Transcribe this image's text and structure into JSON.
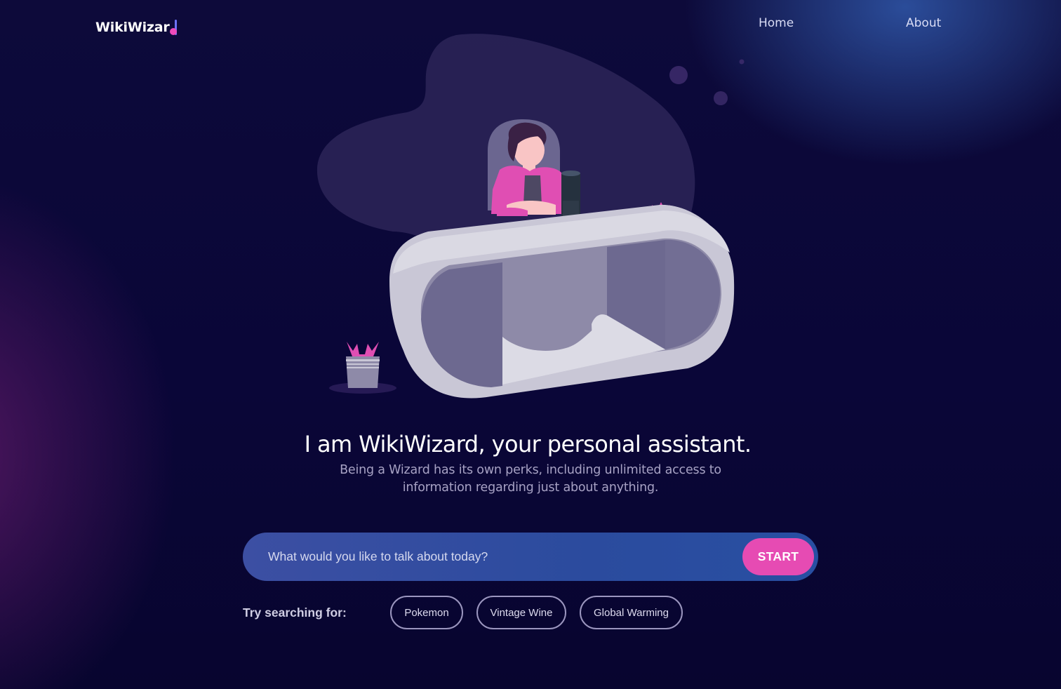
{
  "app": {
    "logo_text": "WikiWizar"
  },
  "nav": {
    "home": "Home",
    "about": "About"
  },
  "hero": {
    "headline": "I am WikiWizard, your personal assistant.",
    "subline": "Being a Wizard has its own perks, including unlimited access to information regarding just about anything."
  },
  "search": {
    "placeholder": "What would you like to talk about today?",
    "value": "",
    "button_label": "START"
  },
  "suggestions": {
    "label": "Try searching for:",
    "items": [
      "Pokemon",
      "Vintage Wine",
      "Global Warming"
    ]
  },
  "colors": {
    "background": "#0a0638",
    "accent_pink": "#e64bb3",
    "search_bar": "#2b4b9e",
    "logo_bar": "#6d73ff"
  },
  "icons": {
    "logo_mark": "note-mark-icon"
  }
}
